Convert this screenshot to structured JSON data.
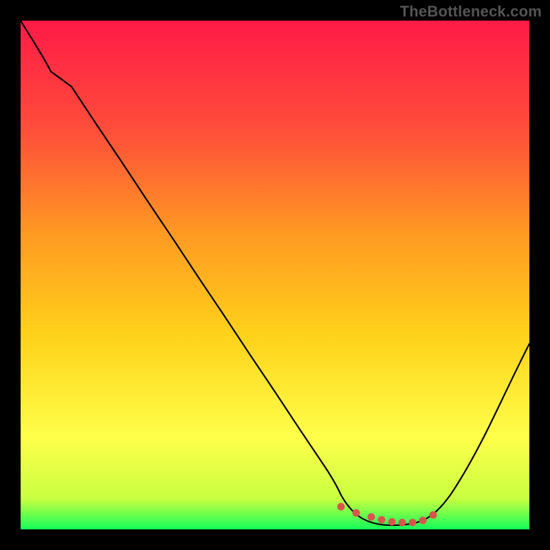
{
  "watermark": "TheBottleneck.com",
  "colors": {
    "gradient_top": "#ff1a47",
    "gradient_mid_upper": "#ff6a2a",
    "gradient_mid": "#ffd21a",
    "gradient_mid_lower": "#ffff4a",
    "gradient_bottom": "#13ff5a",
    "curve": "#000000",
    "dots": "#d9544d",
    "frame": "#000000"
  },
  "chart_data": {
    "type": "line",
    "title": "",
    "xlabel": "",
    "ylabel": "",
    "xlim": [
      0,
      100
    ],
    "ylim": [
      0,
      100
    ],
    "grid": false,
    "legend": false,
    "annotations": [],
    "series": [
      {
        "name": "bottleneck-curve",
        "x": [
          0,
          3,
          6,
          10,
          15,
          20,
          25,
          30,
          35,
          40,
          45,
          50,
          55,
          60,
          63,
          66,
          69,
          72,
          75,
          78,
          81,
          84,
          87,
          90,
          93,
          96,
          100
        ],
        "y": [
          100,
          96,
          92.5,
          87,
          79.5,
          72,
          64.5,
          57,
          49.5,
          42,
          34.5,
          27,
          19.5,
          12,
          8,
          5,
          3,
          1.5,
          1,
          1,
          2,
          4.5,
          9,
          15,
          22,
          30,
          41
        ]
      }
    ],
    "highlight_points": {
      "name": "optimal-band-dots",
      "x": [
        63,
        66,
        69,
        71,
        73,
        75,
        77,
        79,
        81
      ],
      "y": [
        4.5,
        3.2,
        2.4,
        1.9,
        1.5,
        1.3,
        1.4,
        1.8,
        2.8
      ]
    }
  }
}
